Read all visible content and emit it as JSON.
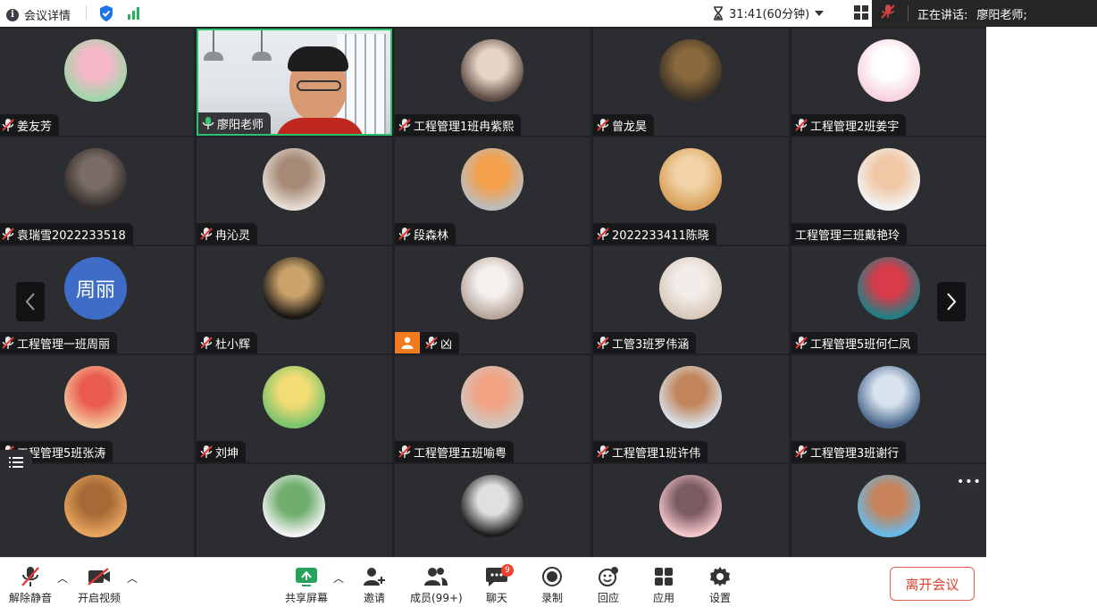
{
  "topbar": {
    "meeting_info_label": "会议详情",
    "timer": "31:41(60分钟)",
    "speaking_label": "正在讲话:",
    "speaking_name": "廖阳老师;"
  },
  "participants": [
    {
      "name": "姜友芳",
      "mic": "off"
    },
    {
      "name": "廖阳老师",
      "mic": "on",
      "video": true
    },
    {
      "name": "工程管理1班冉紫熙",
      "mic": "off"
    },
    {
      "name": "曾龙昊",
      "mic": "off"
    },
    {
      "name": "工程管理2班姜宇",
      "mic": "off"
    },
    {
      "name": "袁瑞雪2022233518",
      "mic": "off"
    },
    {
      "name": "冉沁灵",
      "mic": "off"
    },
    {
      "name": "段森林",
      "mic": "off"
    },
    {
      "name": "2022233411陈晓",
      "mic": "off"
    },
    {
      "name": "工程管理三班戴艳玲",
      "mic": "none"
    },
    {
      "name": "工程管理一班周丽",
      "mic": "off",
      "avatar_text": "周丽"
    },
    {
      "name": "杜小辉",
      "mic": "off"
    },
    {
      "name": "凶",
      "mic": "off",
      "host": true
    },
    {
      "name": "工管3班罗伟涵",
      "mic": "off"
    },
    {
      "name": "工程管理5班何仁凤",
      "mic": "off"
    },
    {
      "name": "工程管理5班张涛",
      "mic": "off"
    },
    {
      "name": "刘坤",
      "mic": "off"
    },
    {
      "name": "工程管理五班喻粤",
      "mic": "off"
    },
    {
      "name": "工程管理1班许伟",
      "mic": "off"
    },
    {
      "name": "工程管理3班谢行",
      "mic": "off"
    },
    {
      "name": "",
      "mic": "none"
    },
    {
      "name": "",
      "mic": "none"
    },
    {
      "name": "",
      "mic": "none"
    },
    {
      "name": "",
      "mic": "none"
    },
    {
      "name": "",
      "mic": "none"
    }
  ],
  "avatar_colors": [
    [
      "#9fd6a8",
      "#f4b8c8"
    ],
    null,
    [
      "#5b4a42",
      "#e8d4c5"
    ],
    [
      "#3b3026",
      "#8a6a3c"
    ],
    [
      "#f7d2dd",
      "#ffffff"
    ],
    [
      "#2f2b2a",
      "#7b6d66"
    ],
    [
      "#e6ddd5",
      "#a68a76"
    ],
    [
      "#bcbcbc",
      "#f4a04b"
    ],
    [
      "#d9a05b",
      "#f2d2a7"
    ],
    [
      "#f2f2f2",
      "#f1c8a6"
    ],
    null,
    [
      "#1a1714",
      "#caa26a"
    ],
    [
      "#b7a59a",
      "#f3f0ee"
    ],
    [
      "#d8c9bb",
      "#f2ede8"
    ],
    [
      "#1f7f86",
      "#d83b49"
    ],
    [
      "#f2c49b",
      "#e95b4c"
    ],
    [
      "#7bc46d",
      "#f2dc74"
    ],
    [
      "#cfc6bf",
      "#f2a383"
    ],
    [
      "#d8e0e8",
      "#c2855b"
    ],
    [
      "#4b6a8e",
      "#d8e3ef"
    ],
    [
      "#e8a55d",
      "#a56a35"
    ],
    [
      "#f3f3f3",
      "#6fae6d"
    ],
    [
      "#1d1d1d",
      "#e0e0e0"
    ],
    [
      "#f4c7cc",
      "#7a5b61"
    ],
    [
      "#65b9e8",
      "#c9835a"
    ]
  ],
  "toolbar": {
    "unmute": "解除静音",
    "start_video": "开启视频",
    "share_screen": "共享屏幕",
    "invite": "邀请",
    "members": "成员(99+)",
    "chat": "聊天",
    "chat_badge": "9",
    "record": "录制",
    "reactions": "回应",
    "apps": "应用",
    "settings": "设置",
    "leave": "离开会议"
  },
  "colors": {
    "grid_bg": "#1f2124",
    "tile_bg": "#2b2d31",
    "active_border": "#27c26a",
    "host_badge": "#f17b1e",
    "leave": "#e0402d"
  }
}
